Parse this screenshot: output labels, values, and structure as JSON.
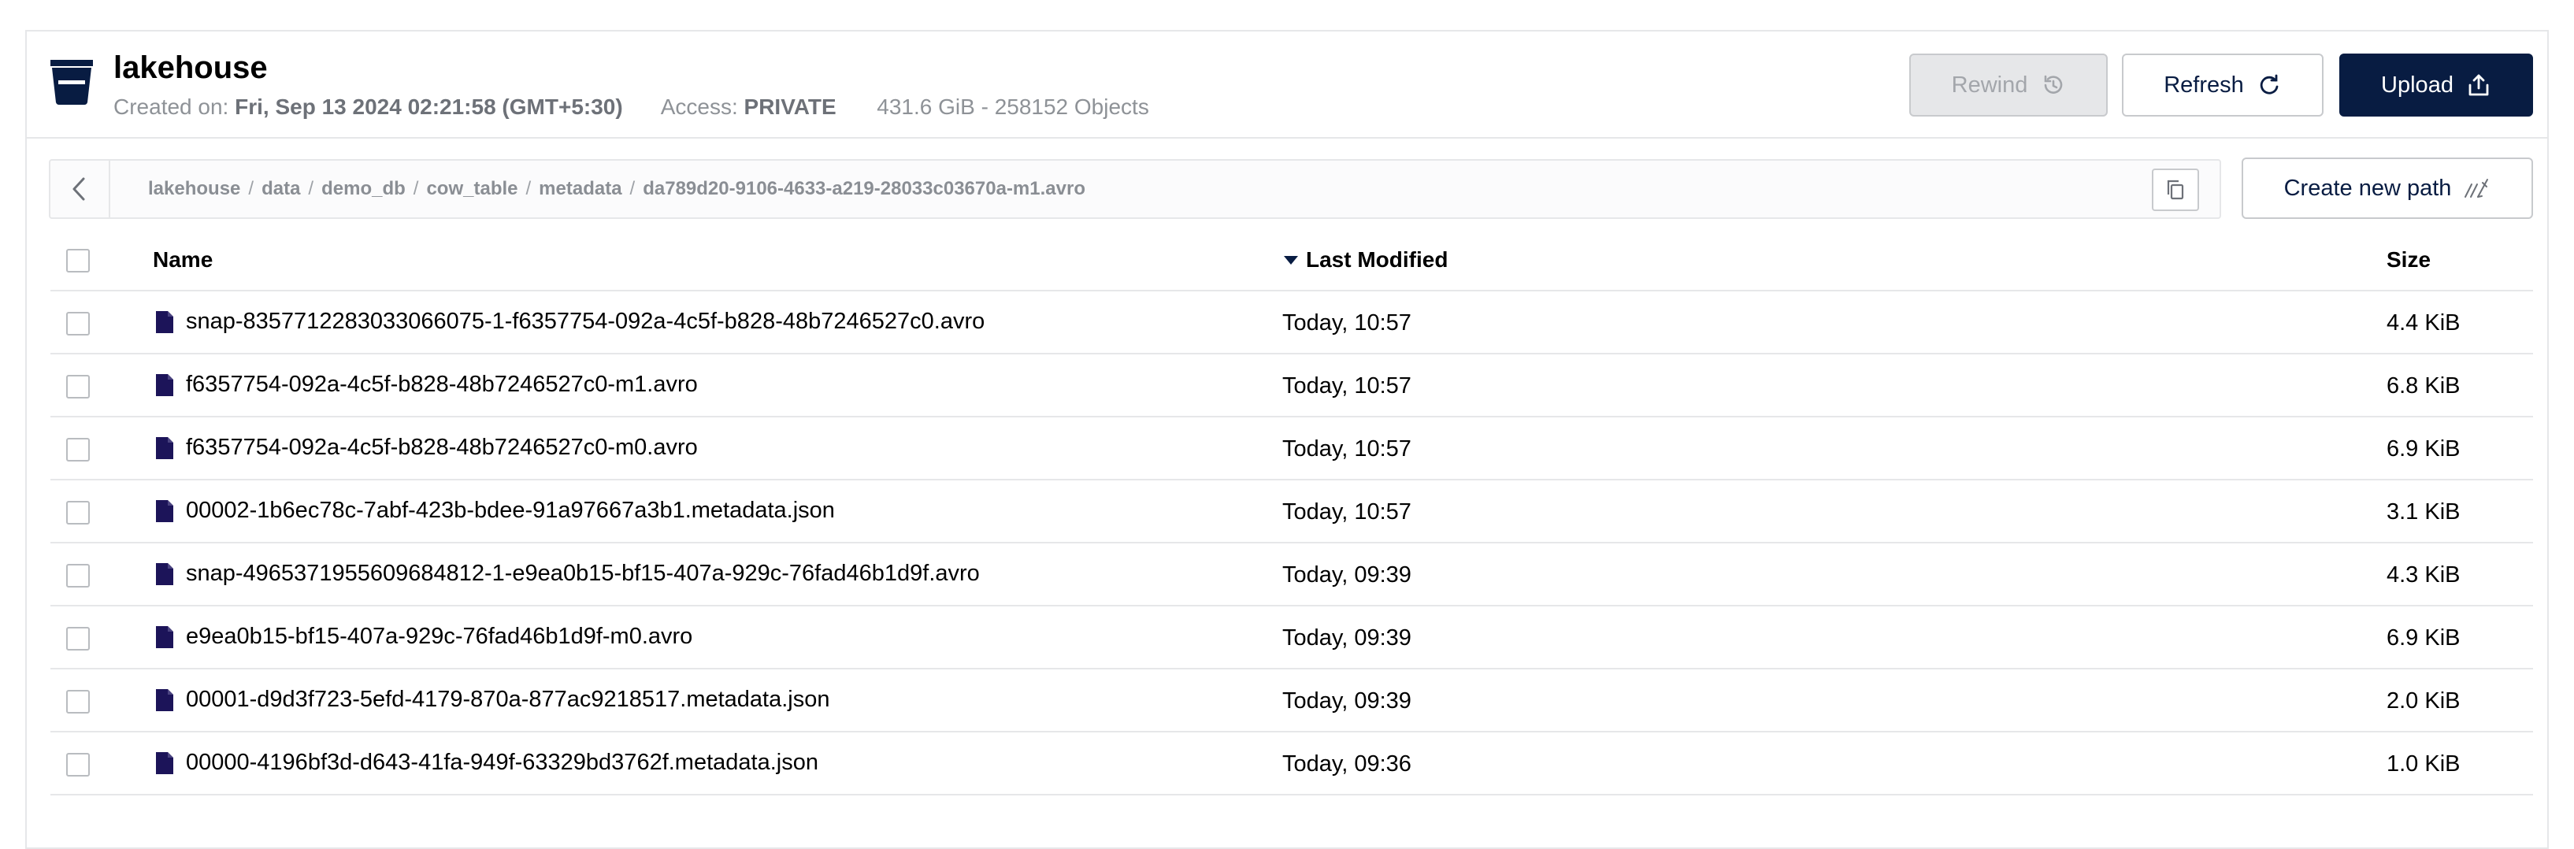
{
  "bucket": {
    "name": "lakehouse",
    "created_label": "Created on:",
    "created_value": "Fri, Sep 13 2024 02:21:58 (GMT+5:30)",
    "access_label": "Access:",
    "access_value": "PRIVATE",
    "usage": "431.6 GiB - 258152 Objects",
    "icon": "bucket-icon"
  },
  "toolbar": {
    "rewind_label": "Rewind",
    "rewind_disabled": true,
    "refresh_label": "Refresh",
    "upload_label": "Upload",
    "create_path_label": "Create new path"
  },
  "breadcrumb": {
    "segments": [
      "lakehouse",
      "data",
      "demo_db",
      "cow_table",
      "metadata",
      "da789d20-9106-4633-a219-28033c03670a-m1.avro"
    ],
    "separator": "/"
  },
  "table": {
    "columns": {
      "name": "Name",
      "modified": "Last Modified",
      "size": "Size"
    },
    "sort": {
      "column": "modified",
      "direction": "desc"
    },
    "rows": [
      {
        "name": "snap-8357712283033066075-1-f6357754-092a-4c5f-b828-48b7246527c0.avro",
        "modified": "Today, 10:57",
        "size": "4.4 KiB"
      },
      {
        "name": "f6357754-092a-4c5f-b828-48b7246527c0-m1.avro",
        "modified": "Today, 10:57",
        "size": "6.8 KiB"
      },
      {
        "name": "f6357754-092a-4c5f-b828-48b7246527c0-m0.avro",
        "modified": "Today, 10:57",
        "size": "6.9 KiB"
      },
      {
        "name": "00002-1b6ec78c-7abf-423b-bdee-91a97667a3b1.metadata.json",
        "modified": "Today, 10:57",
        "size": "3.1 KiB"
      },
      {
        "name": "snap-4965371955609684812-1-e9ea0b15-bf15-407a-929c-76fad46b1d9f.avro",
        "modified": "Today, 09:39",
        "size": "4.3 KiB"
      },
      {
        "name": "e9ea0b15-bf15-407a-929c-76fad46b1d9f-m0.avro",
        "modified": "Today, 09:39",
        "size": "6.9 KiB"
      },
      {
        "name": "00001-d9d3f723-5efd-4179-870a-877ac9218517.metadata.json",
        "modified": "Today, 09:39",
        "size": "2.0 KiB"
      },
      {
        "name": "00000-4196bf3d-d643-41fa-949f-63329bd3762f.metadata.json",
        "modified": "Today, 09:36",
        "size": "1.0 KiB"
      }
    ]
  },
  "colors": {
    "primary": "#081C42",
    "file_icon": "#1C1459",
    "border": "#E6E7E9",
    "muted_text": "#8E9297"
  }
}
